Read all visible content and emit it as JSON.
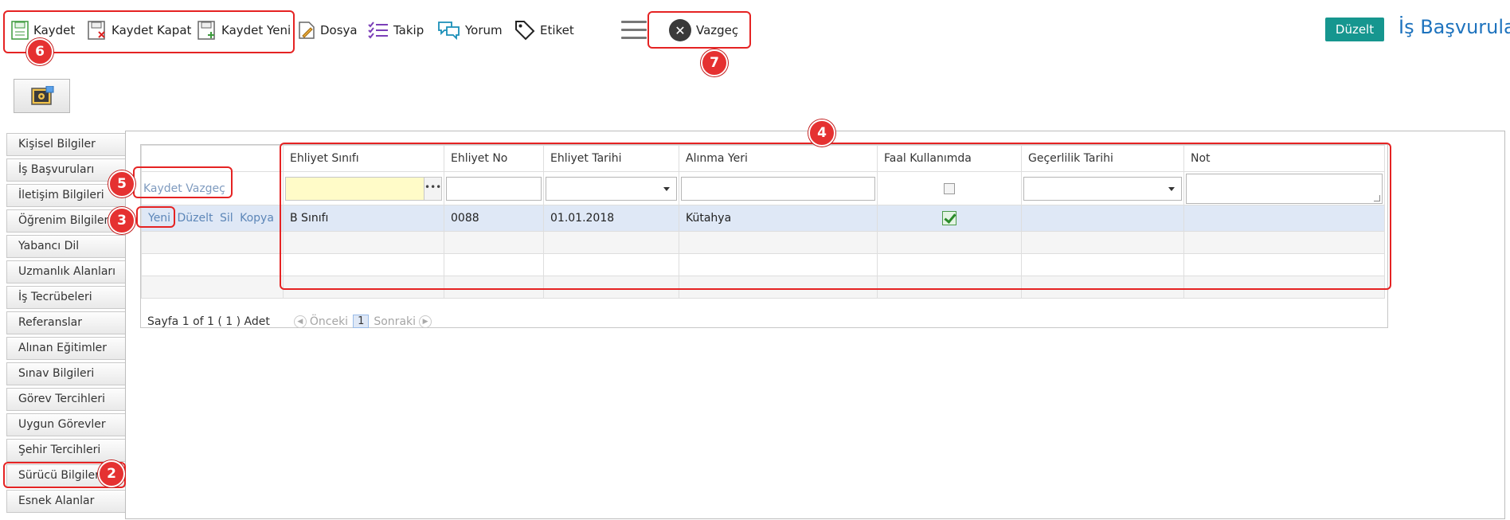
{
  "toolbar": {
    "kaydet": "Kaydet",
    "kaydet_kapat": "Kaydet Kapat",
    "kaydet_yeni": "Kaydet Yeni",
    "dosya": "Dosya",
    "takip": "Takip",
    "yorum": "Yorum",
    "etiket": "Etiket",
    "vazgec": "Vazgeç",
    "duzelt": "Düzelt",
    "page_title": "İş Başvuruları"
  },
  "sidebar": {
    "items": [
      {
        "label": "Kişisel Bilgiler"
      },
      {
        "label": "İş Başvuruları"
      },
      {
        "label": "İletişim Bilgileri"
      },
      {
        "label": "Öğrenim Bilgileri"
      },
      {
        "label": "Yabancı Dil"
      },
      {
        "label": "Uzmanlık Alanları"
      },
      {
        "label": "İş Tecrübeleri"
      },
      {
        "label": "Referanslar"
      },
      {
        "label": "Alınan Eğitimler"
      },
      {
        "label": "Sınav Bilgileri"
      },
      {
        "label": "Görev Tercihleri"
      },
      {
        "label": "Uygun Görevler"
      },
      {
        "label": "Şehir Tercihleri"
      },
      {
        "label": "Sürücü Bilgileri"
      },
      {
        "label": "Esnek Alanlar"
      }
    ]
  },
  "grid": {
    "columns": [
      "Ehliyet Sınıfı",
      "Ehliyet No",
      "Ehliyet Tarihi",
      "Alınma Yeri",
      "Faal Kullanımda",
      "Geçerlilik Tarihi",
      "Not"
    ],
    "filter_actions": {
      "kaydet": "Kaydet",
      "vazgec": "Vazgeç"
    },
    "row_actions": {
      "yeni": "Yeni",
      "duzelt": "Düzelt",
      "sil": "Sil",
      "kopya": "Kopya"
    },
    "rows": [
      {
        "ehliyet_sinifi": "B Sınıfı",
        "ehliyet_no": "0088",
        "ehliyet_tarihi": "01.01.2018",
        "alinma_yeri": "Kütahya",
        "faal": true,
        "gecerlilik": "",
        "not": ""
      }
    ]
  },
  "pager": {
    "info": "Sayfa 1 of 1 ( 1 ) Adet",
    "prev": "Önceki",
    "page": "1",
    "next": "Sonraki"
  },
  "annotations": [
    "2",
    "3",
    "4",
    "5",
    "6",
    "7"
  ],
  "colors": {
    "accent": "#16968f",
    "title": "#1e73be",
    "annotation": "#e52323",
    "selected_row": "#dfe8f6"
  }
}
